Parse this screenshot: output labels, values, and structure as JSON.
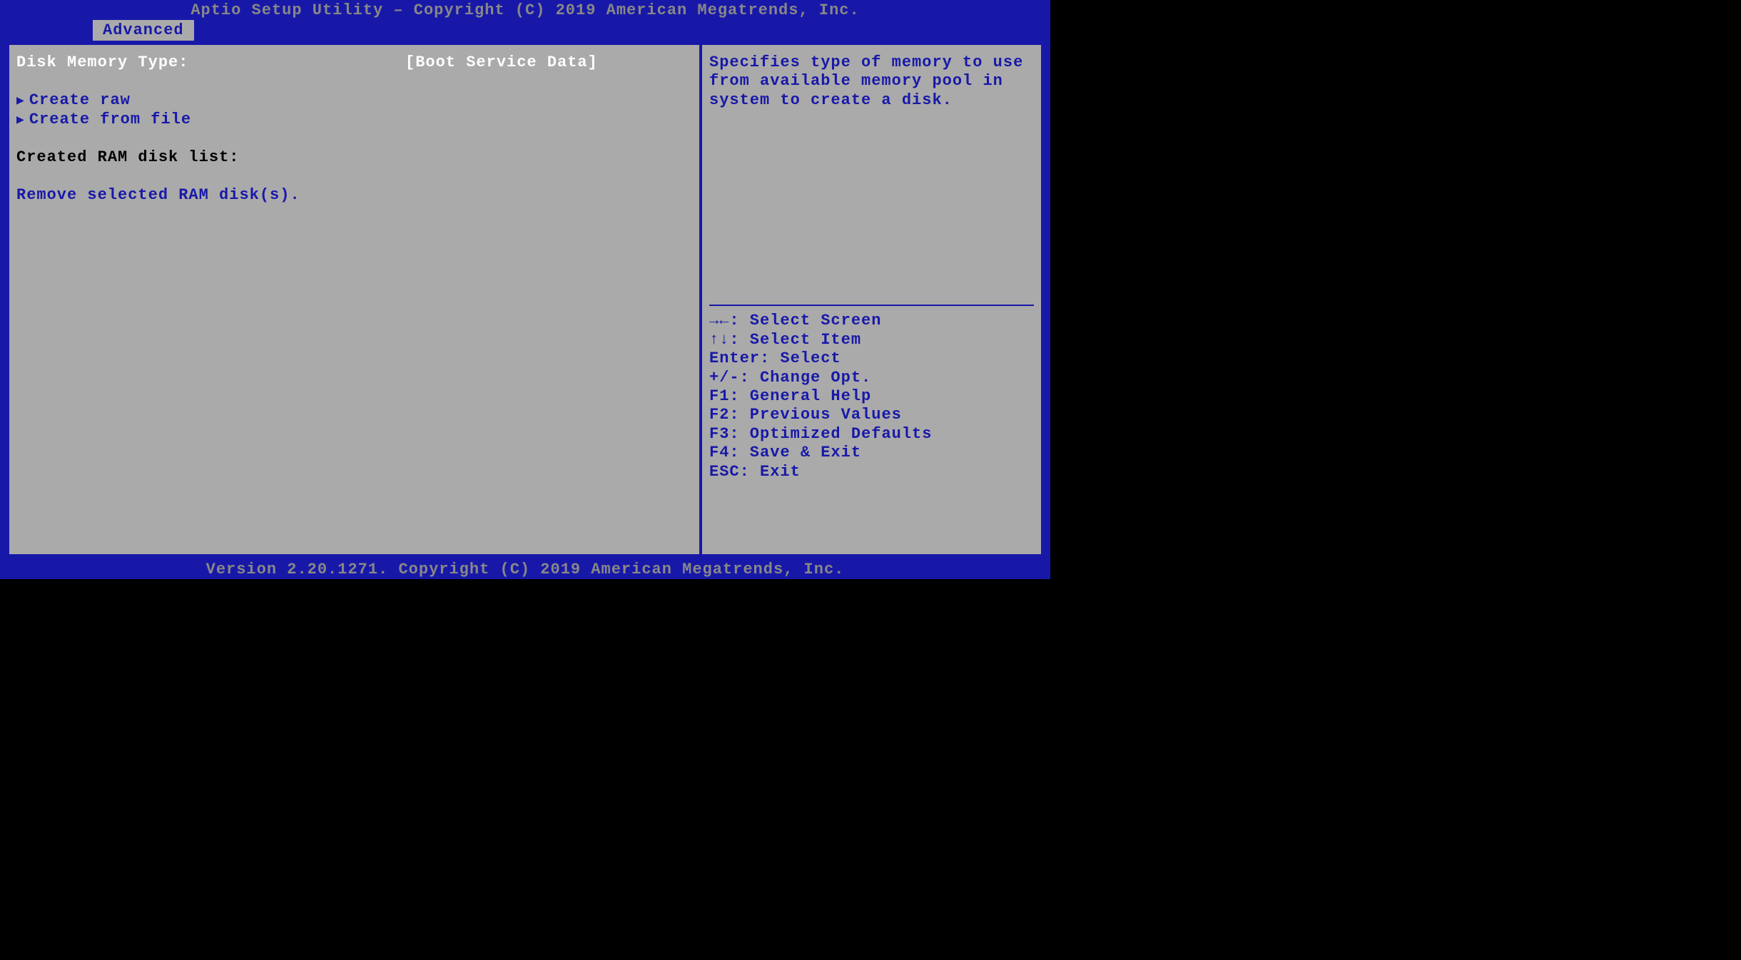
{
  "header": {
    "title": "Aptio Setup Utility – Copyright (C) 2019 American Megatrends, Inc."
  },
  "tabs": {
    "active": "Advanced"
  },
  "main": {
    "setting": {
      "label": "Disk Memory Type:",
      "value": "[Boot Service Data]"
    },
    "menu_items": [
      {
        "label": "Create raw"
      },
      {
        "label": "Create from file"
      }
    ],
    "list_header": "Created RAM disk list:",
    "action": "Remove selected RAM disk(s)."
  },
  "help": {
    "description": "Specifies type of memory to use from available memory pool in system to create a disk.",
    "keys": [
      {
        "sym": "→←",
        "label": ": Select Screen"
      },
      {
        "sym": "↑↓",
        "label": ": Select Item"
      },
      {
        "sym": "Enter",
        "label": ": Select"
      },
      {
        "sym": "+/-",
        "label": ": Change Opt."
      },
      {
        "sym": "F1",
        "label": ": General Help"
      },
      {
        "sym": "F2",
        "label": ": Previous Values"
      },
      {
        "sym": "F3",
        "label": ": Optimized Defaults"
      },
      {
        "sym": "F4",
        "label": ": Save & Exit"
      },
      {
        "sym": "ESC",
        "label": ": Exit"
      }
    ]
  },
  "footer": {
    "version": "Version 2.20.1271. Copyright (C) 2019 American Megatrends, Inc."
  }
}
